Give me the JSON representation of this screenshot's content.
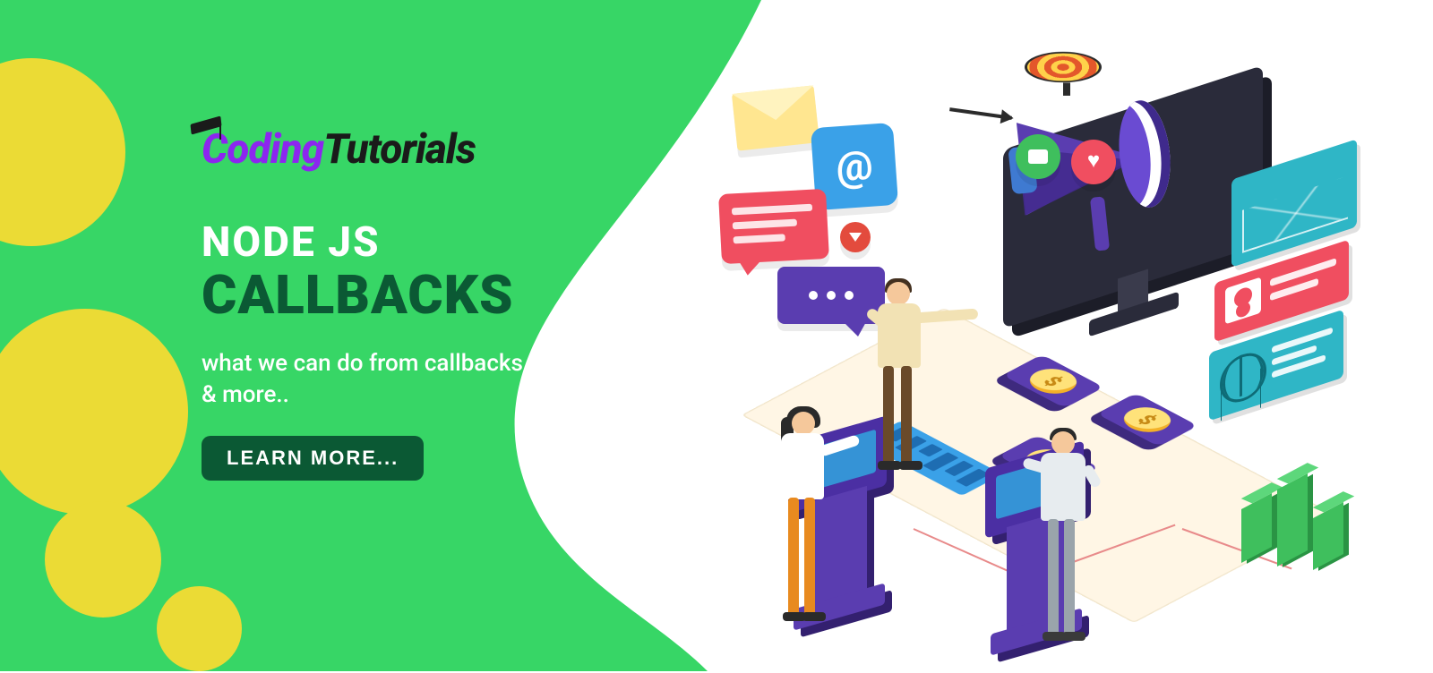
{
  "logo": {
    "part1": "Coding",
    "part2": "Tutorials"
  },
  "hero": {
    "eyebrow": "NODE JS",
    "title": "CALLBACKS",
    "subtitle": "what we can do from callbacks & more..",
    "cta_label": "LEARN MORE..."
  },
  "illustration": {
    "at_symbol": "@",
    "coin_symbol": "$"
  },
  "colors": {
    "primary_green": "#37d666",
    "dark_green": "#0b5934",
    "yellow": "#ebdb35",
    "purple": "#5a3db0",
    "logo_purple": "#8c26ef",
    "red": "#f04e60",
    "blue": "#3aa1e8",
    "teal": "#2fb6c6",
    "orange": "#e88a1f"
  }
}
